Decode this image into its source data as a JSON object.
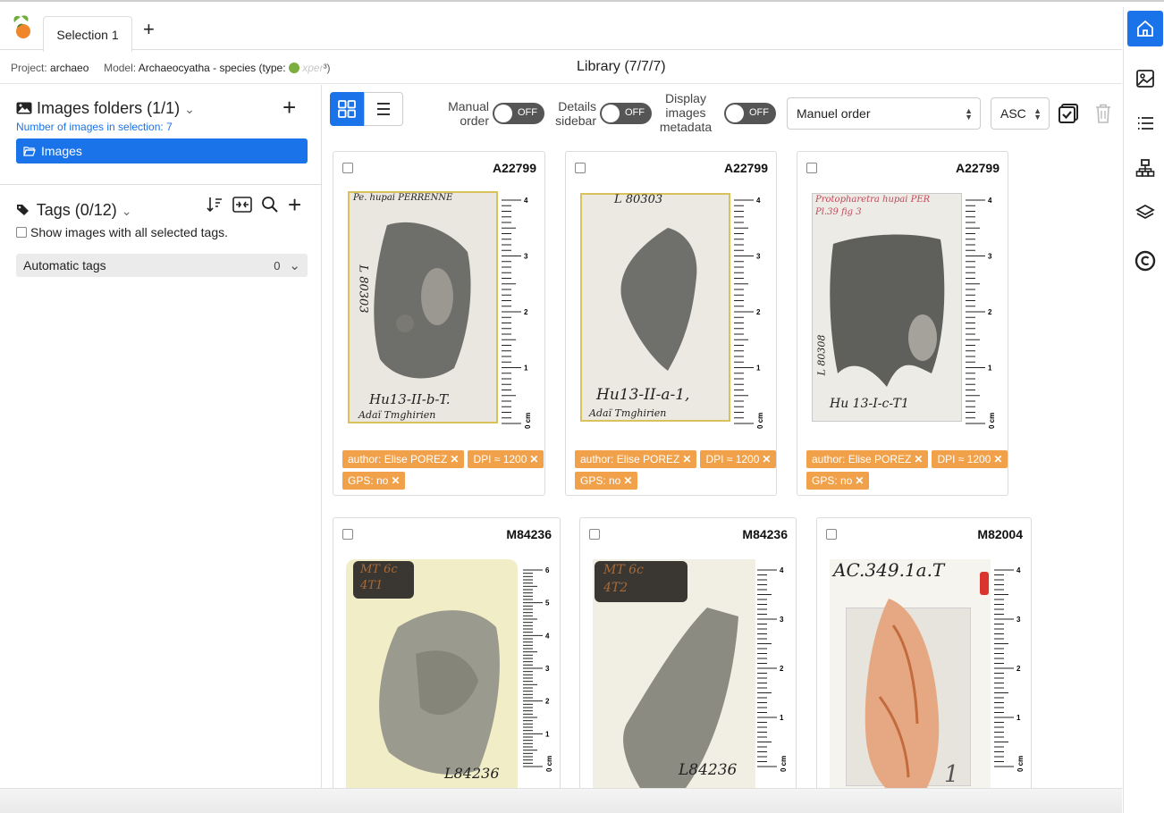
{
  "tabs": {
    "active": "Selection 1",
    "add": "+"
  },
  "info": {
    "project_label": "Project:",
    "project_value": "archaeo",
    "model_label": "Model:",
    "model_value": "Archaeocyatha - species (type:",
    "model_type": "xper",
    "model_end": "³)"
  },
  "library_title": "Library (7/7/7)",
  "folders": {
    "title": "Images folders (1/1)",
    "count_text": "Number of images in selection: 7",
    "add": "+",
    "items": [
      {
        "label": "Images"
      }
    ]
  },
  "tags": {
    "title": "Tags (0/12)",
    "show_all_label": "Show images with all selected tags.",
    "automatic_label": "Automatic tags",
    "automatic_count": "0",
    "add": "+"
  },
  "toolbar": {
    "manual_order_label": [
      "Manual",
      "order"
    ],
    "details_label": [
      "Details",
      "sidebar"
    ],
    "metadata_label": [
      "Display",
      "images",
      "metadata"
    ],
    "toggle_off": "OFF",
    "order_value": "Manuel order",
    "direction_value": "ASC"
  },
  "cards": [
    {
      "id": "A22799",
      "handwriting_top": "Pe. hupai  PERRENNE",
      "handwriting_bottom": "Hu13-II-b-T.",
      "handwriting_bottom2": "Adaï Tmghirien",
      "side": "L 80303",
      "chips": [
        "author: Elise POREZ",
        "DPI ≈ 1200",
        "GPS: no"
      ]
    },
    {
      "id": "A22799",
      "handwriting_top": "L 80303",
      "handwriting_bottom": "Hu13-II-a-1,",
      "handwriting_bottom2": "Adaï Tmghirien",
      "side": "",
      "chips": [
        "author: Elise POREZ",
        "DPI ≈ 1200",
        "GPS: no"
      ]
    },
    {
      "id": "A22799",
      "handwriting_top": "Protopharetra hupai PER",
      "handwriting_top2": "Pl.39 fig 3",
      "handwriting_bottom": "Hu 13-I-c-T1",
      "side": "L 80308",
      "chips": [
        "author: Elise POREZ",
        "DPI ≈ 1200",
        "GPS: no"
      ]
    },
    {
      "id": "M84236",
      "label_box": [
        "MT 6c",
        "4T1"
      ],
      "handwriting_bottom": "L84236",
      "chips": []
    },
    {
      "id": "M84236",
      "label_box": [
        "MT 6c",
        "4T2"
      ],
      "handwriting_bottom": "L84236",
      "chips": []
    },
    {
      "id": "M82004",
      "handwriting_top": "AC.349.1a.T",
      "handwriting_bottom": "1",
      "chips": []
    }
  ],
  "scale": {
    "unit": "0 cm",
    "ticks_a": [
      "1",
      "2",
      "3",
      "4"
    ],
    "ticks_b": [
      "1",
      "2",
      "3",
      "4",
      "5",
      "6"
    ]
  }
}
